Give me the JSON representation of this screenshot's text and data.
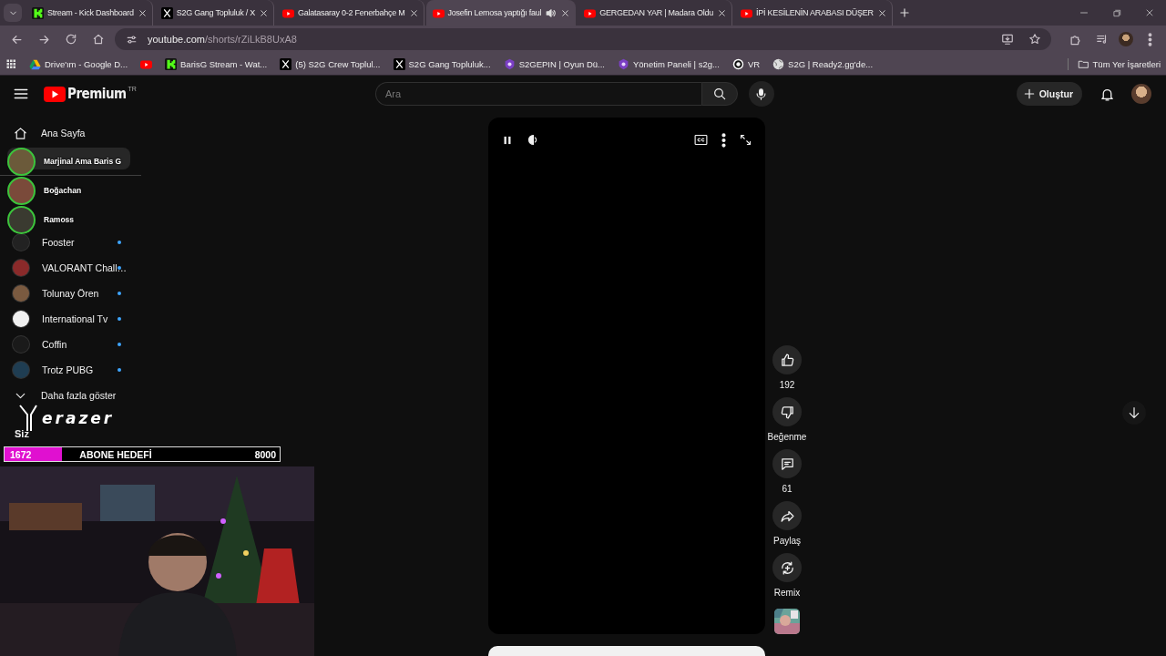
{
  "browser": {
    "tabs": [
      {
        "title": "Stream - Kick Dashboard",
        "selected": false,
        "audio": false
      },
      {
        "title": "S2G Gang Topluluk / X",
        "selected": false,
        "audio": false
      },
      {
        "title": "Galatasaray 0-2 Fenerbahçe M",
        "selected": false,
        "audio": false
      },
      {
        "title": "Josefin Lemosa yaptığı faul",
        "selected": true,
        "audio": true
      },
      {
        "title": "GERGEDAN YAR | Madara Oldu",
        "selected": false,
        "audio": false
      },
      {
        "title": "İPİ KESİLENİN ARABASI DÜŞER",
        "selected": false,
        "audio": false
      }
    ],
    "address": {
      "host": "youtube.com",
      "path": "/shorts/rZiLkB8UxA8"
    },
    "bookmarks": [
      {
        "kind": "link",
        "label": "Drive'ım - Google D..."
      },
      {
        "kind": "icon"
      },
      {
        "kind": "link",
        "label": "BarisG Stream - Wat..."
      },
      {
        "kind": "link",
        "label": "(5) S2G Crew Toplul..."
      },
      {
        "kind": "link",
        "label": "S2G Gang Topluluk..."
      },
      {
        "kind": "link",
        "label": "S2GEPIN | Oyun Dü..."
      },
      {
        "kind": "link",
        "label": "Yönetim Paneli | s2g..."
      },
      {
        "kind": "link",
        "label": "VR"
      },
      {
        "kind": "link",
        "label": "S2G | Ready2.gg'de..."
      }
    ],
    "all_bookmarks": "Tüm Yer İşaretleri"
  },
  "youtube": {
    "logo_text": "Premium",
    "region": "TR",
    "search": {
      "placeholder": "Ara"
    },
    "create_button": "Oluştur",
    "sidebar": {
      "home": "Ana Sayfa",
      "subscriptions": [
        {
          "name": "Fooster",
          "new": true
        },
        {
          "name": "VALORANT Chall…",
          "new": true
        },
        {
          "name": "Tolunay Ören",
          "new": true
        },
        {
          "name": "International Tv",
          "new": true
        },
        {
          "name": "Coffin",
          "new": true
        },
        {
          "name": "Trotz PUBG",
          "new": true
        }
      ],
      "show_more": "Daha fazla göster",
      "you": "Siz"
    },
    "actions": [
      {
        "kind": "like",
        "label": "192"
      },
      {
        "kind": "dislike",
        "label": "Beğenme"
      },
      {
        "kind": "comment",
        "label": "61"
      },
      {
        "kind": "share",
        "label": "Paylaş"
      },
      {
        "kind": "remix",
        "label": "Remix"
      }
    ]
  },
  "stream_overlay": {
    "viewers": [
      {
        "name": "Marjinal Ama Baris G"
      },
      {
        "name": "Boğachan"
      },
      {
        "name": "Ramoss"
      }
    ],
    "sponsor": "erazer",
    "goal": {
      "current": "1672",
      "title": "ABONE HEDEFİ",
      "target": "8000",
      "level": 0.209
    }
  }
}
